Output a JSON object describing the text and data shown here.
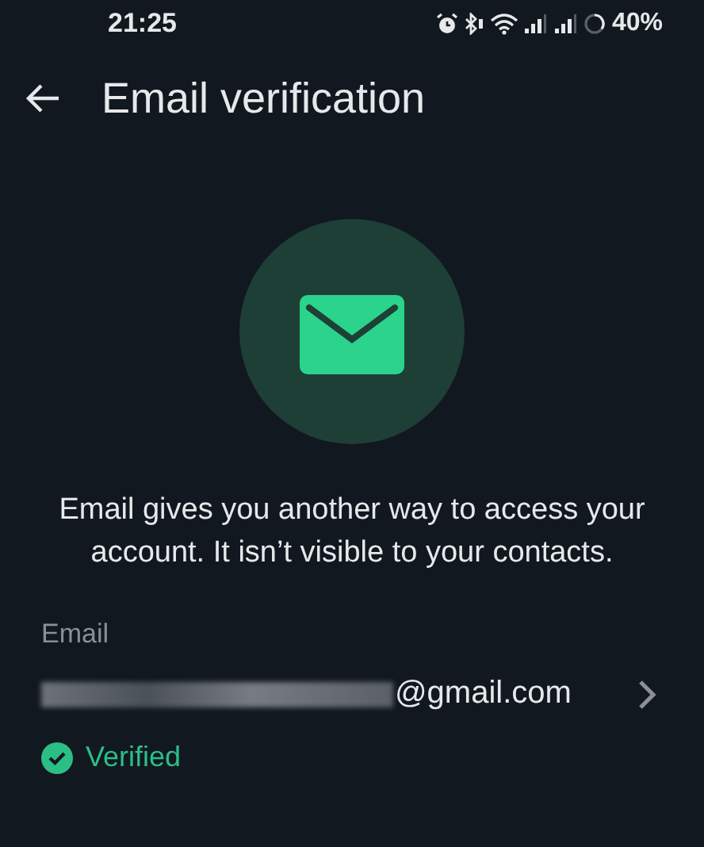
{
  "status_bar": {
    "time": "21:25",
    "battery": "40%"
  },
  "header": {
    "title": "Email verification"
  },
  "description": "Email gives you another way to access your account. It isn’t visible to your contacts.",
  "email": {
    "label": "Email",
    "value": "@gmail.com",
    "verified": true,
    "verified_label": "Verified"
  }
}
